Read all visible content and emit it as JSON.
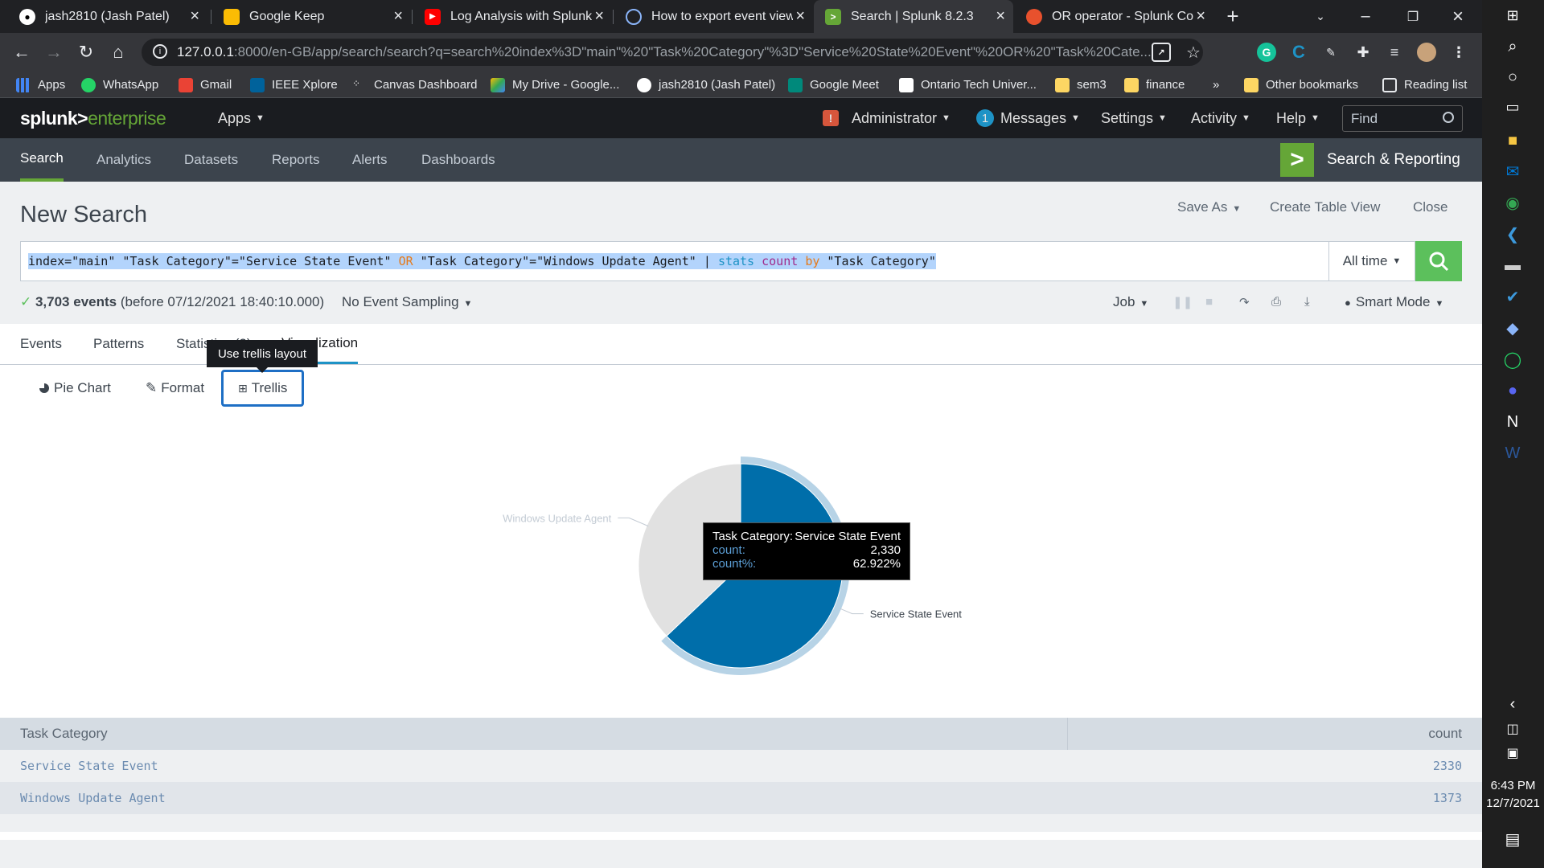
{
  "browser": {
    "tabs": [
      {
        "title": "jash2810 (Jash Patel)",
        "favicon": "github-icon",
        "active": false
      },
      {
        "title": "Google Keep",
        "favicon": "keep-icon",
        "active": false
      },
      {
        "title": "Log Analysis with Splunk",
        "favicon": "youtube-icon",
        "active": false
      },
      {
        "title": "How to export event view",
        "favicon": "loading-icon",
        "active": false
      },
      {
        "title": "Search | Splunk 8.2.3",
        "favicon": "splunk-icon",
        "active": true
      },
      {
        "title": "OR operator - Splunk Cor",
        "favicon": "splunk-community-icon",
        "active": false
      }
    ],
    "url_host": "127.0.0.1",
    "url_rest": ":8000/en-GB/app/search/search?q=search%20index%3D\"main\"%20\"Task%20Category\"%3D\"Service%20State%20Event\"%20OR%20\"Task%20Cate...",
    "bookmarks": [
      "Apps",
      "WhatsApp",
      "Gmail",
      "IEEE Xplore",
      "Canvas Dashboard",
      "My Drive - Google...",
      "jash2810 (Jash Patel)",
      "Google Meet",
      "Ontario Tech Univer...",
      "sem3",
      "finance"
    ],
    "bookmarks_more": "»",
    "other_bookmarks": "Other bookmarks",
    "reading_list": "Reading list"
  },
  "splunk": {
    "logo_main": "splunk>",
    "logo_sub": "enterprise",
    "apps": "Apps",
    "admin": "Administrator",
    "messages_count": "1",
    "messages": "Messages",
    "settings": "Settings",
    "activity": "Activity",
    "help": "Help",
    "find_placeholder": "Find",
    "nav": [
      "Search",
      "Analytics",
      "Datasets",
      "Reports",
      "Alerts",
      "Dashboards"
    ],
    "app_name": "Search & Reporting"
  },
  "search": {
    "title": "New Search",
    "save_as": "Save As",
    "create_table": "Create Table View",
    "close": "Close",
    "q1": "index=\"main\" \"Task Category\"=\"Service State Event\" ",
    "q_or": "OR",
    "q2": " \"Task Category\"=\"Windows Update Agent\" | ",
    "q_stats": "stats",
    "q3": " ",
    "q_count": "count",
    "q4": " ",
    "q_by": "by",
    "q5": " \"Task Category\"",
    "time_range": "All time",
    "event_count": "3,703 events",
    "event_suffix": "(before 07/12/2021 18:40:10.000)",
    "sampling": "No Event Sampling",
    "job": "Job",
    "mode": "Smart Mode"
  },
  "results": {
    "tabs": [
      "Events",
      "Patterns",
      "Statistics (2)",
      "Visualization"
    ],
    "viz_buttons": [
      "Pie Chart",
      "Format",
      "Trellis"
    ],
    "trellis_tooltip": "Use trellis layout"
  },
  "chart_data": {
    "type": "pie",
    "slices": [
      {
        "label": "Service State Event",
        "value": 2330,
        "color": "#006eaa"
      },
      {
        "label": "Windows Update Agent",
        "value": 1373,
        "color": "#e1e1e1"
      }
    ],
    "tooltip": {
      "field_label": "Task Category:",
      "field_value": "Service State Event",
      "count_label": "count:",
      "count_value": "2,330",
      "pct_label": "count%:",
      "pct_value": "62.922%"
    }
  },
  "table": {
    "headers": [
      "Task Category",
      "count"
    ],
    "rows": [
      {
        "category": "Service State Event",
        "count": "2330"
      },
      {
        "category": "Windows Update Agent",
        "count": "1373"
      }
    ]
  },
  "taskbar": {
    "time": "6:43 PM",
    "date": "12/7/2021"
  }
}
